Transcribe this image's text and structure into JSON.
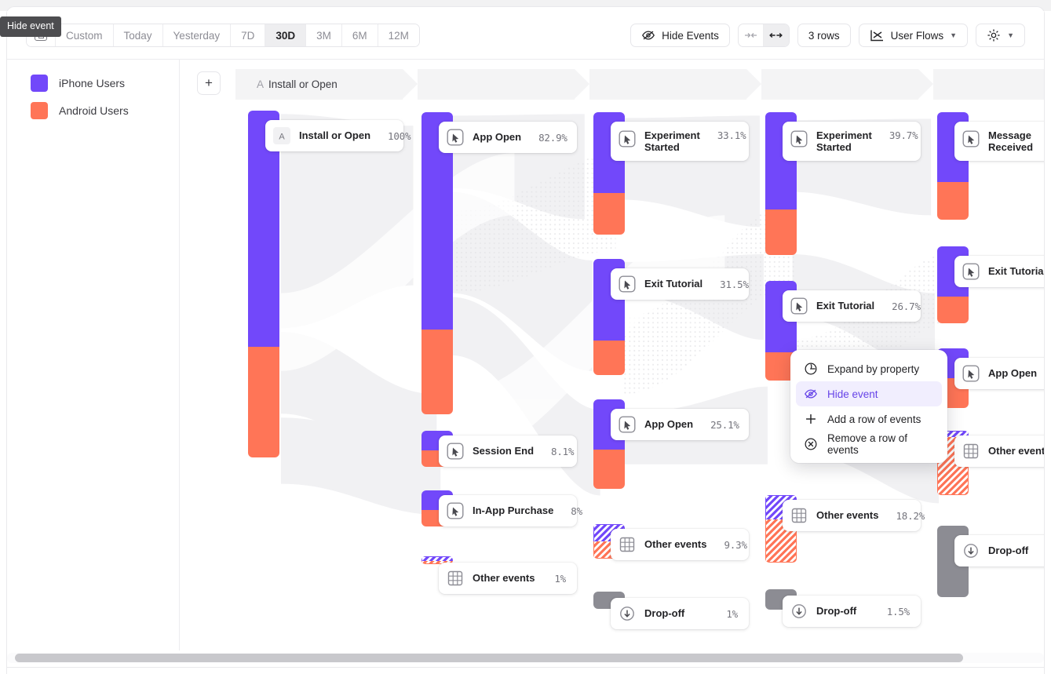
{
  "tooltip": {
    "text": "Hide event"
  },
  "toolbar": {
    "date_ranges": [
      {
        "label": "Custom",
        "active": false,
        "icon": "calendar-icon"
      },
      {
        "label": "Today",
        "active": false
      },
      {
        "label": "Yesterday",
        "active": false
      },
      {
        "label": "7D",
        "active": false
      },
      {
        "label": "30D",
        "active": true
      },
      {
        "label": "3M",
        "active": false
      },
      {
        "label": "6M",
        "active": false
      },
      {
        "label": "12M",
        "active": false
      }
    ],
    "hide_events_label": "Hide Events",
    "collapse_icon": "collapse-horizontal-icon",
    "expand_icon": "expand-horizontal-icon",
    "rows_label": "3 rows",
    "chart_type_label": "User Flows",
    "settings_icon": "gear-icon"
  },
  "legend": {
    "items": [
      {
        "label": "iPhone Users",
        "color": "#7248fa"
      },
      {
        "label": "Android Users",
        "color": "#ff7557"
      }
    ]
  },
  "canvas": {
    "add_column_label": "+",
    "headers": [
      {
        "prefix": "A",
        "label": "Install or Open"
      },
      {
        "prefix": "",
        "label": ""
      },
      {
        "prefix": "",
        "label": ""
      },
      {
        "prefix": "",
        "label": ""
      },
      {
        "prefix": "",
        "label": ""
      }
    ]
  },
  "context_menu": {
    "items": [
      {
        "label": "Expand by property",
        "icon": "expand-property-icon",
        "active": false
      },
      {
        "label": "Hide event",
        "icon": "hide-eye-icon",
        "active": true
      },
      {
        "label": "Add a row of events",
        "icon": "plus-icon",
        "active": false
      },
      {
        "label": "Remove a row of events",
        "icon": "remove-circle-icon",
        "active": false
      }
    ]
  },
  "chart_data": {
    "type": "sankey",
    "title": "User Flows",
    "series": [
      {
        "name": "iPhone Users",
        "color": "#7248fa"
      },
      {
        "name": "Android Users",
        "color": "#ff7557"
      }
    ],
    "columns": [
      {
        "index": 0,
        "nodes": [
          {
            "label": "Install or Open",
            "percent": "100%",
            "icon": "letter-a-icon",
            "iphone_share": 0.68,
            "android_share": 0.32,
            "kind": "solid"
          }
        ]
      },
      {
        "index": 1,
        "nodes": [
          {
            "label": "App Open",
            "percent": "82.9%",
            "icon": "cursor-icon",
            "iphone_share": 0.72,
            "android_share": 0.28,
            "kind": "solid"
          },
          {
            "label": "Session End",
            "percent": "8.1%",
            "icon": "cursor-icon",
            "iphone_share": 0.55,
            "android_share": 0.45,
            "kind": "solid"
          },
          {
            "label": "In-App Purchase",
            "percent": "8%",
            "icon": "cursor-icon",
            "iphone_share": 0.55,
            "android_share": 0.45,
            "kind": "solid"
          },
          {
            "label": "Other events",
            "percent": "1%",
            "icon": "grid-icon",
            "iphone_share": 0.6,
            "android_share": 0.4,
            "kind": "hatched"
          }
        ]
      },
      {
        "index": 2,
        "nodes": [
          {
            "label": "Experiment Started",
            "percent": "33.1%",
            "icon": "cursor-icon",
            "iphone_share": 0.66,
            "android_share": 0.34,
            "kind": "solid"
          },
          {
            "label": "Exit Tutorial",
            "percent": "31.5%",
            "icon": "cursor-icon",
            "iphone_share": 0.7,
            "android_share": 0.3,
            "kind": "solid"
          },
          {
            "label": "App Open",
            "percent": "25.1%",
            "icon": "cursor-icon",
            "iphone_share": 0.56,
            "android_share": 0.44,
            "kind": "solid"
          },
          {
            "label": "Other events",
            "percent": "9.3%",
            "icon": "grid-icon",
            "iphone_share": 0.5,
            "android_share": 0.5,
            "kind": "hatched"
          },
          {
            "label": "Drop-off",
            "percent": "1%",
            "icon": "drop-off-icon",
            "kind": "grey"
          }
        ]
      },
      {
        "index": 3,
        "nodes": [
          {
            "label": "Experiment Started",
            "percent": "39.7%",
            "icon": "cursor-icon",
            "iphone_share": 0.68,
            "android_share": 0.32,
            "kind": "solid"
          },
          {
            "label": "Exit Tutorial",
            "percent": "26.7%",
            "icon": "cursor-icon",
            "iphone_share": 0.72,
            "android_share": 0.28,
            "kind": "solid"
          },
          {
            "label": "Other events",
            "percent": "18.2%",
            "icon": "grid-icon",
            "iphone_share": 0.36,
            "android_share": 0.64,
            "kind": "hatched"
          },
          {
            "label": "Drop-off",
            "percent": "1.5%",
            "icon": "drop-off-icon",
            "kind": "grey"
          }
        ]
      },
      {
        "index": 4,
        "nodes": [
          {
            "label": "Message Received",
            "percent": "",
            "icon": "cursor-icon",
            "iphone_share": 0.65,
            "android_share": 0.35,
            "kind": "solid"
          },
          {
            "label": "Exit Tutorial",
            "percent": "",
            "icon": "cursor-icon",
            "iphone_share": 0.65,
            "android_share": 0.35,
            "kind": "solid"
          },
          {
            "label": "App Open",
            "percent": "",
            "icon": "cursor-icon",
            "iphone_share": 0.5,
            "android_share": 0.5,
            "kind": "solid"
          },
          {
            "label": "Other events",
            "percent": "",
            "icon": "grid-icon",
            "iphone_share": 0.1,
            "android_share": 0.9,
            "kind": "hatched"
          },
          {
            "label": "Drop-off",
            "percent": "",
            "icon": "drop-off-icon",
            "kind": "grey"
          }
        ]
      }
    ]
  }
}
